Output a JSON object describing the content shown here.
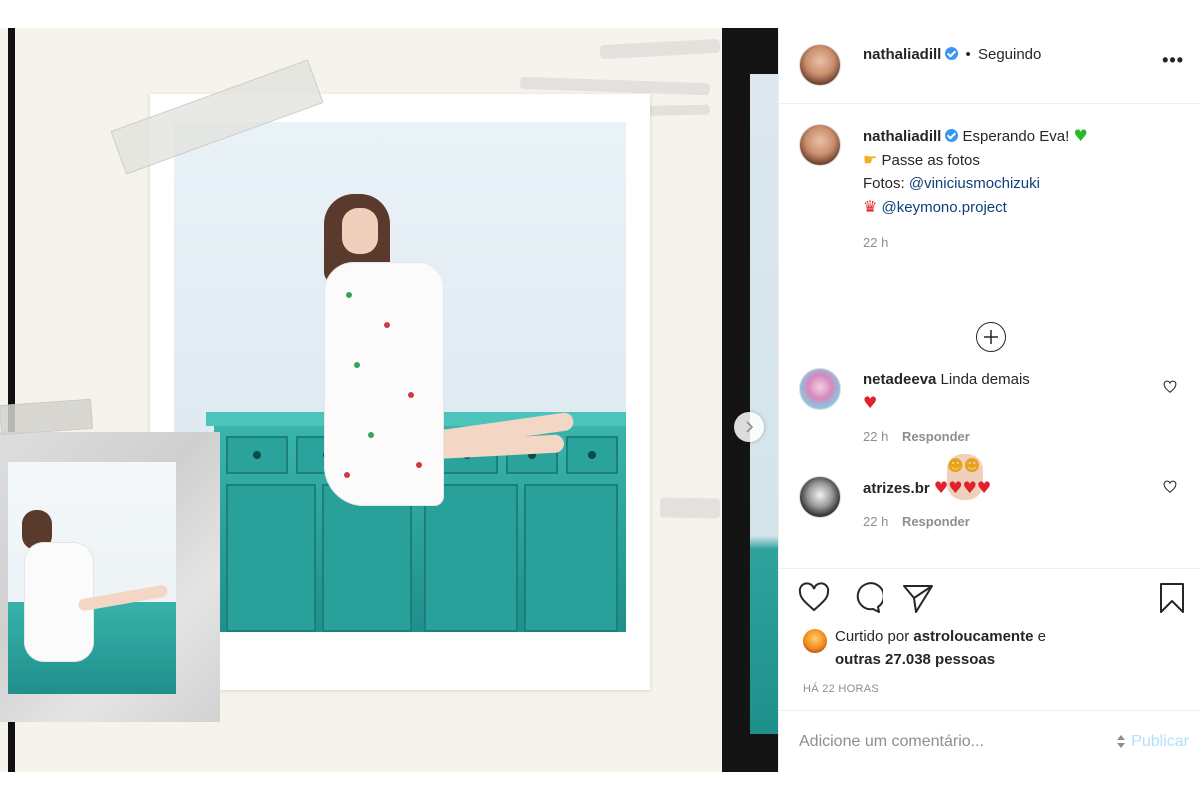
{
  "post": {
    "author": "nathaliadill",
    "follow_separator": "•",
    "follow_status": "Seguindo",
    "more_label": "•••"
  },
  "caption": {
    "username": "nathaliadill",
    "line1": "Esperando Eva!",
    "line1_emoji": "♥",
    "line2_emoji": "☛",
    "line2": "Passe as fotos",
    "line3_prefix": "Fotos:",
    "line3_link": "@viniciusmochizuki",
    "line4_emoji": "♛",
    "line4_link": "@keymono.project",
    "time": "22 h"
  },
  "load_more_icon": "plus-circle-icon",
  "comments": [
    {
      "username": "netadeeva",
      "text": "Linda demais",
      "emojis": "☻☻",
      "emoji2": "♥",
      "time": "22 h",
      "reply_label": "Responder"
    },
    {
      "username": "atrizes.br",
      "text": "",
      "emojis": "♥♥♥♥",
      "time": "22 h",
      "reply_label": "Responder"
    }
  ],
  "likes": {
    "prefix": "Curtido por",
    "user": "astroloucamente",
    "connector": "e",
    "others": "outras 27.038 pessoas"
  },
  "timestamp": "HÁ 22 HORAS",
  "add_comment": {
    "placeholder": "Adicione um comentário...",
    "publish_label": "Publicar"
  },
  "colors": {
    "link": "#0f3f7a",
    "muted": "#8e8e8e",
    "publish_disabled": "#b2dffc",
    "verified": "#3897f0",
    "dresser_teal": "#2aa39c"
  }
}
